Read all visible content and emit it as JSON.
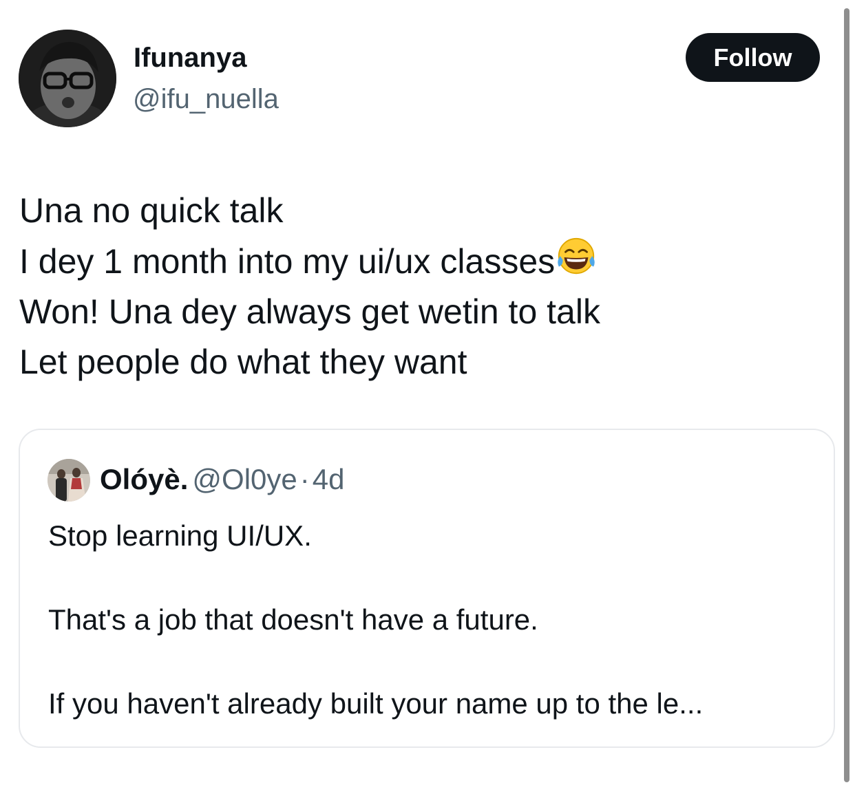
{
  "author": {
    "display_name": "Ifunanya",
    "handle": "@ifu_nuella",
    "avatar_icon": "profile-photo"
  },
  "follow_button": {
    "label": "Follow"
  },
  "tweet": {
    "lines": [
      "Una no quick talk",
      "I dey 1 month into my ui/ux classes",
      "Won! Una dey always get wetin to talk",
      "Let people do what they want"
    ],
    "emoji": "face-with-tears-of-joy"
  },
  "quoted_tweet": {
    "display_name": "Olóyè.",
    "handle": "@Ol0ye",
    "separator": "·",
    "time": "4d",
    "paragraphs": [
      "Stop learning UI/UX.",
      "That's a job that doesn't have a future.",
      "If you haven't already built your name up to the le..."
    ]
  },
  "colors": {
    "text_primary": "#0f1419",
    "text_secondary": "#536471",
    "button_bg": "#0f1419",
    "button_text": "#ffffff",
    "quote_border": "#e7e9ec"
  }
}
